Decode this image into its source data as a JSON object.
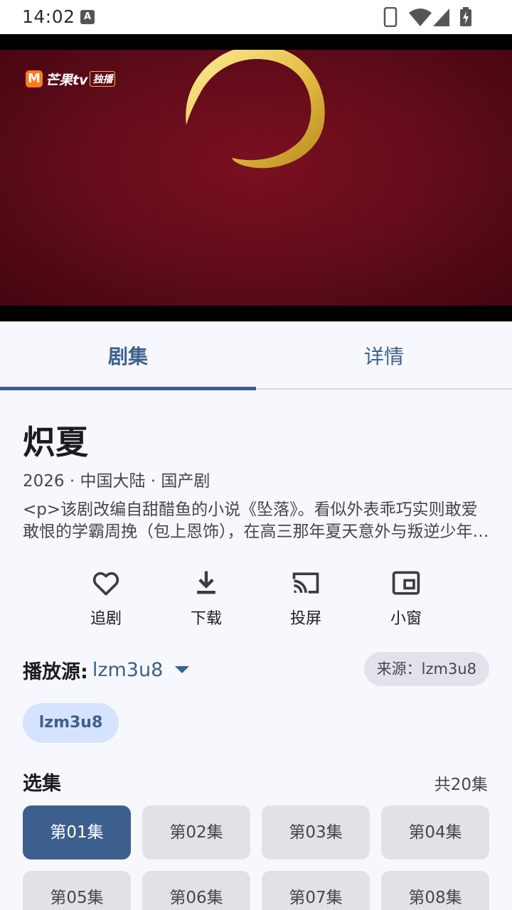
{
  "status_bar": {
    "time": "14:02",
    "notification_icon": "A"
  },
  "player": {
    "logo_m": "M",
    "logo_text": "芒果tv",
    "logo_badge": "独播"
  },
  "tabs": [
    {
      "label": "剧集",
      "selected": true
    },
    {
      "label": "详情",
      "selected": false
    }
  ],
  "show": {
    "title": "炽夏",
    "meta": "2026 · 中国大陆 · 国产剧",
    "description": "<p>该剧改编自甜醋鱼的小说《坠落》。看似外表乖巧实则敢爱敢恨的学霸周挽（包上恩饰），在高三那年夏天意外与叛逆少年相遇…"
  },
  "actions": [
    {
      "label": "追剧",
      "icon": "heart-icon"
    },
    {
      "label": "下载",
      "icon": "download-icon"
    },
    {
      "label": "投屏",
      "icon": "cast-icon"
    },
    {
      "label": "小窗",
      "icon": "picture-in-picture-icon"
    }
  ],
  "source": {
    "label": "播放源:",
    "value": "lzm3u8",
    "chip": "来源：lzm3u8"
  },
  "line": {
    "label": "lzm3u8"
  },
  "episodes": {
    "title": "选集",
    "count": "共20集",
    "items": [
      {
        "label": "第01集",
        "active": true
      },
      {
        "label": "第02集",
        "active": false
      },
      {
        "label": "第03集",
        "active": false
      },
      {
        "label": "第04集",
        "active": false
      },
      {
        "label": "第05集",
        "active": false
      },
      {
        "label": "第06集",
        "active": false
      },
      {
        "label": "第07集",
        "active": false
      },
      {
        "label": "第08集",
        "active": false
      }
    ]
  },
  "colors": {
    "accent": "#3d5f8e",
    "background": "#f7f8fd",
    "chip": "#e1e2e8",
    "line_chip": "#d6e3ff",
    "video_red": "#650c1c"
  }
}
